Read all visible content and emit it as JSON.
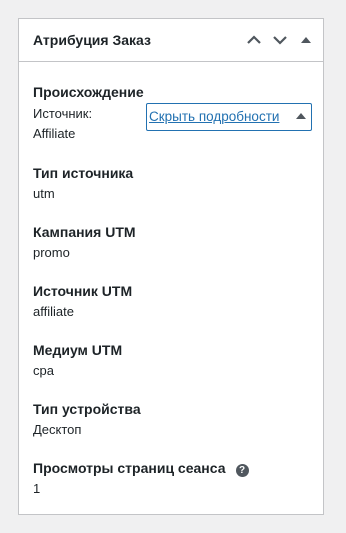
{
  "panel": {
    "title": "Атрибуция Заказ",
    "actions": {
      "move_up_icon": "chevron-up-icon",
      "move_down_icon": "chevron-down-icon",
      "toggle_icon": "triangle-up-icon"
    }
  },
  "origin": {
    "label": "Происхождение",
    "source_prefix": "Источник:",
    "source_value": "Affiliate",
    "toggle_label": "Скрыть подробности"
  },
  "fields": [
    {
      "label": "Тип источника",
      "value": "utm"
    },
    {
      "label": "Кампания UTM",
      "value": "promo"
    },
    {
      "label": "Источник UTM",
      "value": "affiliate"
    },
    {
      "label": "Медиум UTM",
      "value": "cpa"
    },
    {
      "label": "Тип устройства",
      "value": "Десктоп"
    },
    {
      "label": "Просмотры страниц сеанса",
      "value": "1",
      "help_icon": "?"
    }
  ],
  "colors": {
    "link": "#2271b1",
    "border": "#c3c4c7",
    "text": "#1d2327",
    "background": "#f0f0f1"
  }
}
